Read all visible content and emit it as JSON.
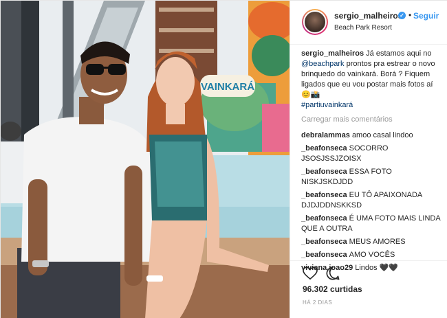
{
  "post": {
    "username": "sergio_malheiros",
    "follow_label": "Seguir",
    "location": "Beach Park Resort",
    "caption": {
      "username": "sergio_malheiros",
      "text_before": "Já estamos aqui no ",
      "mention": "@beachpark",
      "text_after": " prontos pra estrear o novo brinquedo do vainkará. Borá ? Fiquem ligados que eu vou postar mais fotos aí 😊📸",
      "hashtag": "#partiuvainkará"
    },
    "load_more_label": "Carregar mais comentários",
    "comments": [
      {
        "user": "debralammas",
        "text": "amoo casal lindoo"
      },
      {
        "user": "_beafonseca",
        "text": "SOCORRO JSOSJSSJZOISX"
      },
      {
        "user": "_beafonseca",
        "text": "ESSA FOTO NISKJSKDJDD"
      },
      {
        "user": "_beafonseca",
        "text": "EU TÔ APAIXONADA DJDJDDNSKKSD"
      },
      {
        "user": "_beafonseca",
        "text": "É UMA FOTO MAIS LINDA QUE A OUTRA"
      },
      {
        "user": "_beafonseca",
        "text": "MEUS AMORES"
      },
      {
        "user": "_beafonseca",
        "text": "AMO VOCÊS"
      },
      {
        "user": "viviana.joao29",
        "text": "Lindos 🖤🖤"
      }
    ],
    "likes_label": "96.302 curtidas",
    "time_label": "HÁ 2 DIAS",
    "photo_sign_text": "VAINKARÁ",
    "icons": {
      "like": "heart-icon",
      "comment": "comment-bubble-icon",
      "verified": "verified-badge-icon"
    },
    "colors": {
      "link": "#3897f0",
      "mention": "#003569",
      "muted": "#999999"
    }
  }
}
